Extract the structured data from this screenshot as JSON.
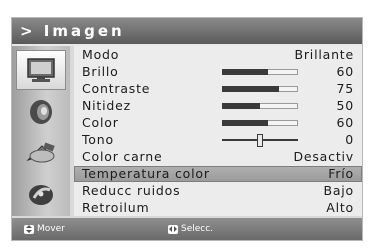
{
  "menu": {
    "title": "> Imagen",
    "items": [
      {
        "label": "Modo",
        "value": "Brillante",
        "type": "value"
      },
      {
        "label": "Brillo",
        "value": "60",
        "type": "slider",
        "level": 0.6
      },
      {
        "label": "Contraste",
        "value": "75",
        "type": "slider",
        "level": 0.75
      },
      {
        "label": "Nitidez",
        "value": "50",
        "type": "slider",
        "level": 0.5
      },
      {
        "label": "Color",
        "value": "60",
        "type": "slider",
        "level": 0.6
      },
      {
        "label": "Tono",
        "value": "0",
        "type": "balance",
        "level": 0.5
      },
      {
        "label": "Color carne",
        "value": "Desactiv",
        "type": "value"
      },
      {
        "label": "Temperatura color",
        "value": "Frío",
        "type": "value",
        "selected": true
      },
      {
        "label": "Reducc ruidos",
        "value": "Bajo",
        "type": "value"
      },
      {
        "label": "Retroilum",
        "value": "Alto",
        "type": "value"
      }
    ]
  },
  "sidebar": {
    "icons": [
      "picture-icon",
      "sound-icon",
      "satellite-icon",
      "settings-disc-icon"
    ],
    "active_index": 0
  },
  "footer": {
    "move_label": "Mover",
    "select_label": "Selecc."
  },
  "colors": {
    "title_bar": "#6f6f6f",
    "selected_row": "#a4a4a4",
    "slider_fill": "#3a3a3a"
  }
}
